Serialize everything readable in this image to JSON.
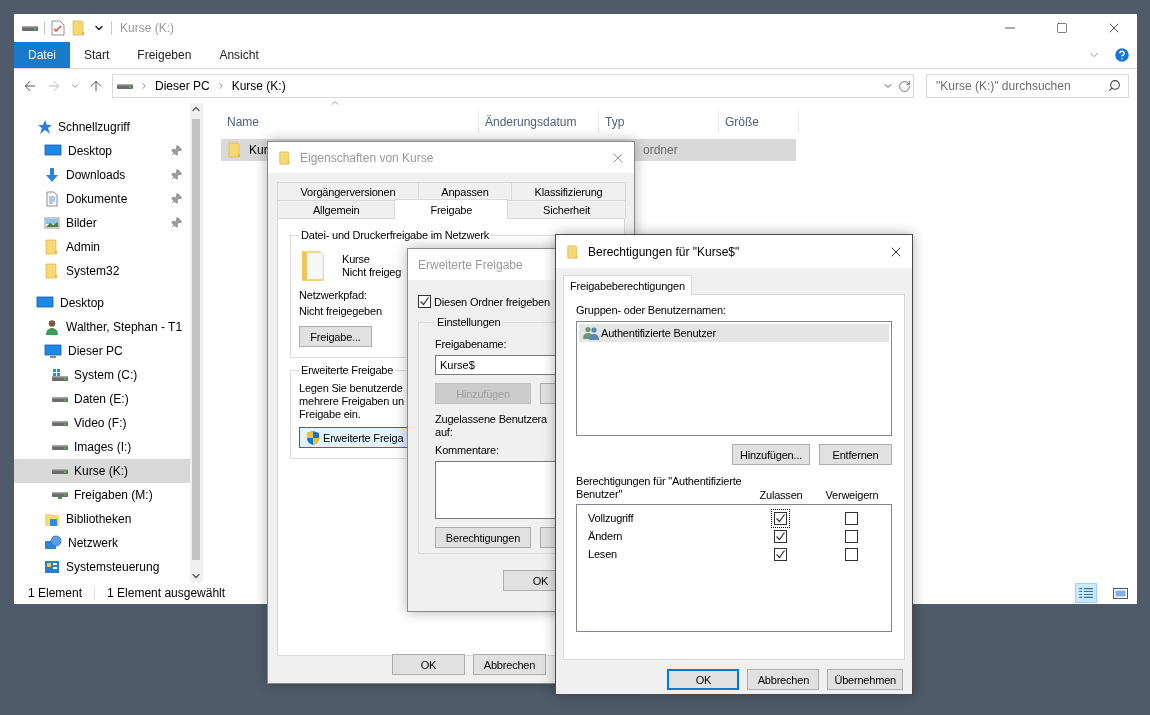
{
  "explorer": {
    "title": "Kurse (K:)",
    "ribbon_tabs": [
      {
        "label": "Datei",
        "kind": "file"
      },
      {
        "label": "Start",
        "kind": "tab"
      },
      {
        "label": "Freigeben",
        "kind": "tab"
      },
      {
        "label": "Ansicht",
        "kind": "tab"
      }
    ],
    "breadcrumb": [
      "Dieser PC",
      "Kurse (K:)"
    ],
    "search": {
      "placeholder": "\"Kurse (K:)\" durchsuchen"
    },
    "sidebar": [
      {
        "label": "Schnellzugriff",
        "kind": "star",
        "pinned": false,
        "selected": false,
        "children": [
          {
            "label": "Desktop",
            "kind": "desktop",
            "pinned": true,
            "selected": false
          },
          {
            "label": "Downloads",
            "kind": "download",
            "pinned": true,
            "selected": false
          },
          {
            "label": "Dokumente",
            "kind": "document",
            "pinned": true,
            "selected": false
          },
          {
            "label": "Bilder",
            "kind": "image",
            "pinned": true,
            "selected": false
          },
          {
            "label": "Admin",
            "kind": "folder",
            "pinned": false,
            "selected": false
          },
          {
            "label": "System32",
            "kind": "folder",
            "pinned": false,
            "selected": false
          }
        ]
      },
      {
        "label": "Desktop",
        "kind": "desktop",
        "pinned": false,
        "selected": false,
        "children": [
          {
            "label": "Walther, Stephan - T1",
            "kind": "user",
            "pinned": false,
            "selected": false
          },
          {
            "label": "Dieser PC",
            "kind": "pc",
            "pinned": false,
            "selected": false,
            "children": [
              {
                "label": "System (C:)",
                "kind": "system-drive",
                "pinned": false,
                "selected": false
              },
              {
                "label": "Daten (E:)",
                "kind": "drive",
                "pinned": false,
                "selected": false
              },
              {
                "label": "Video (F:)",
                "kind": "drive",
                "pinned": false,
                "selected": false
              },
              {
                "label": "Images (I:)",
                "kind": "drive",
                "pinned": false,
                "selected": false
              },
              {
                "label": "Kurse (K:)",
                "kind": "drive",
                "pinned": false,
                "selected": true
              },
              {
                "label": "Freigaben (M:)",
                "kind": "network-drive",
                "pinned": false,
                "selected": false
              }
            ]
          },
          {
            "label": "Bibliotheken",
            "kind": "library",
            "pinned": false,
            "selected": false
          },
          {
            "label": "Netzwerk",
            "kind": "network",
            "pinned": false,
            "selected": false
          },
          {
            "label": "Systemsteuerung",
            "kind": "control-panel",
            "pinned": false,
            "selected": false
          }
        ]
      }
    ],
    "columns": [
      "Name",
      "Änderungsdatum",
      "Typ",
      "Größe"
    ],
    "rows": [
      {
        "name": "Kur",
        "type": "ordner",
        "selected": true
      }
    ],
    "status_bar": [
      "1 Element",
      "1 Element ausgewählt"
    ]
  },
  "properties_dialog": {
    "title": "Eigenschaften von Kurse",
    "active": false,
    "tab_rows": [
      {
        "tabs": [
          {
            "label": "Vorgängerversionen",
            "selected": false
          },
          {
            "label": "Anpassen",
            "selected": false
          },
          {
            "label": "Klassifizierung",
            "selected": false
          }
        ]
      },
      {
        "tabs": [
          {
            "label": "Allgemein",
            "selected": false
          },
          {
            "label": "Freigabe",
            "selected": true
          },
          {
            "label": "Sicherheit",
            "selected": false
          }
        ]
      }
    ],
    "network_group": {
      "legend": "Datei- und Druckerfreigabe im Netzwerk",
      "folder_name": "Kurse",
      "folder_status": "Nicht freigeg",
      "path_label": "Netzwerkpfad:",
      "path_value": "Nicht freigegeben",
      "button": "Freigabe..."
    },
    "advanced_group": {
      "legend": "Erweiterte Freigabe",
      "lines": [
        "Legen Sie benutzerde",
        "mehrere Freigaben un",
        "Freigabe ein."
      ],
      "button": "Erweiterte Freiga"
    },
    "buttons": [
      "OK",
      "Abbrechen"
    ]
  },
  "advanced_dialog": {
    "title": "Erweiterte Freigabe",
    "active": false,
    "share_checkbox": {
      "label": "Diesen Ordner freigeben",
      "checked": true
    },
    "settings": {
      "legend": "Einstellungen",
      "name_label": "Freigabename:",
      "name_value": "Kurse$",
      "add_button": {
        "label": "Hinzufügen",
        "disabled": true
      },
      "limit_label": "Zugelassene Benutzera",
      "limit_label_2": "auf:",
      "comment_label": "Kommentare:",
      "permissions_button": "Berechtigungen"
    },
    "buttons": [
      "OK"
    ]
  },
  "permissions_dialog": {
    "title": "Berechtigungen für \"Kurse$\"",
    "active": true,
    "tabs": [
      {
        "label": "Freigabeberechtigungen",
        "selected": true
      }
    ],
    "groups_label": "Gruppen- oder Benutzernamen:",
    "principals": [
      {
        "name": "Authentifizierte Benutzer",
        "selected": true
      }
    ],
    "principal_buttons": [
      "Hinzufügen...",
      "Entfernen"
    ],
    "permissions_label": "Berechtigungen für \"Authentifizierte Benutzer\"",
    "columns": [
      "Zulassen",
      "Verweigern"
    ],
    "permissions": [
      {
        "name": "Vollzugriff",
        "allow": true,
        "deny": false,
        "focused": true
      },
      {
        "name": "Ändern",
        "allow": true,
        "deny": false,
        "focused": false
      },
      {
        "name": "Lesen",
        "allow": true,
        "deny": false,
        "focused": false
      }
    ],
    "buttons": [
      {
        "label": "OK",
        "default": true
      },
      {
        "label": "Abbrechen",
        "default": false
      },
      {
        "label": "Übernehmen",
        "default": false
      }
    ]
  }
}
